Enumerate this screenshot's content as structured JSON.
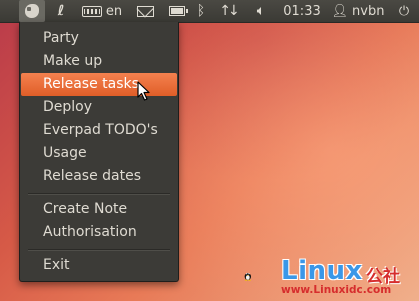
{
  "panel": {
    "keyboard_layout": "en",
    "clock": "01:33",
    "username": "nvbn",
    "icons": [
      "evernote-icon",
      "temperature-icon",
      "keyboard-icon",
      "mail-icon",
      "battery-icon",
      "bluetooth-icon",
      "network-icon",
      "volume-icon",
      "user-icon",
      "power-icon"
    ]
  },
  "menu": {
    "notebooks": [
      {
        "label": "Party"
      },
      {
        "label": "Make up"
      },
      {
        "label": "Release tasks",
        "highlighted": true
      },
      {
        "label": "Deploy"
      },
      {
        "label": "Everpad TODO's"
      },
      {
        "label": "Usage"
      },
      {
        "label": "Release dates"
      }
    ],
    "actions": [
      {
        "label": "Create Note"
      },
      {
        "label": "Authorisation"
      }
    ],
    "exit": {
      "label": "Exit"
    }
  },
  "watermark": {
    "brand": "Linux",
    "chinese": "公社",
    "url": "www.Linuxidc.com"
  },
  "colors": {
    "panel_bg": "#3c3b37",
    "menu_bg": "#3c3b37",
    "highlight": "#e8652f",
    "menu_text": "#dfdbd2"
  }
}
